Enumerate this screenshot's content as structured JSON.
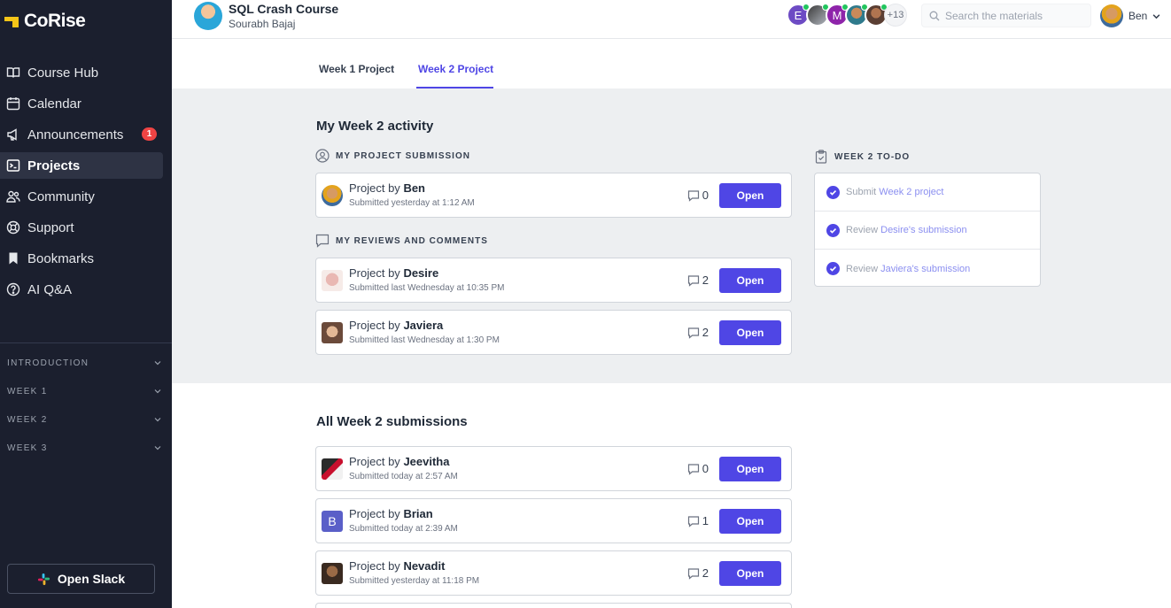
{
  "app": {
    "name": "CoRise"
  },
  "sidebar": {
    "nav": [
      {
        "label": "Course Hub",
        "icon": "book-icon"
      },
      {
        "label": "Calendar",
        "icon": "calendar-icon"
      },
      {
        "label": "Announcements",
        "icon": "megaphone-icon",
        "badge": "1"
      },
      {
        "label": "Projects",
        "icon": "terminal-icon",
        "active": true
      },
      {
        "label": "Community",
        "icon": "people-icon"
      },
      {
        "label": "Support",
        "icon": "lifebuoy-icon"
      },
      {
        "label": "Bookmarks",
        "icon": "bookmark-icon"
      },
      {
        "label": "AI Q&A",
        "icon": "question-icon"
      }
    ],
    "sections": [
      "INTRODUCTION",
      "WEEK 1",
      "WEEK 2",
      "WEEK 3"
    ],
    "slack_label": "Open Slack"
  },
  "header": {
    "course_title": "SQL Crash Course",
    "instructor": "Sourabh Bajaj",
    "avatar_letters": [
      "E",
      "M"
    ],
    "more_count": "+13",
    "search_placeholder": "Search the materials",
    "user_name": "Ben"
  },
  "tabs": [
    {
      "label": "Week 1 Project"
    },
    {
      "label": "Week 2 Project",
      "active": true
    }
  ],
  "activity": {
    "title": "My Week 2 activity",
    "submission_label": "MY PROJECT SUBMISSION",
    "reviews_label": "MY REVIEWS AND COMMENTS",
    "prefix": "Project by",
    "open_label": "Open",
    "my_submission": {
      "name": "Ben",
      "submitted": "Submitted yesterday at 1:12 AM",
      "comments": "0"
    },
    "reviews": [
      {
        "name": "Desire",
        "submitted": "Submitted last Wednesday at 10:35 PM",
        "comments": "2"
      },
      {
        "name": "Javiera",
        "submitted": "Submitted last Wednesday at 1:30 PM",
        "comments": "2"
      }
    ]
  },
  "todo": {
    "title": "WEEK 2 TO-DO",
    "items": [
      {
        "pre": "Submit ",
        "hl": "Week 2 project",
        "post": ""
      },
      {
        "pre": "Review ",
        "hl": "Desire's submission",
        "post": ""
      },
      {
        "pre": "Review ",
        "hl": "Javiera's submission",
        "post": ""
      }
    ]
  },
  "all": {
    "title": "All Week 2 submissions",
    "items": [
      {
        "name": "Jeevitha",
        "submitted": "Submitted today at 2:57 AM",
        "comments": "0"
      },
      {
        "name": "Brian",
        "submitted": "Submitted today at 2:39 AM",
        "comments": "1",
        "initial": "B"
      },
      {
        "name": "Nevadit",
        "submitted": "Submitted yesterday at 11:18 PM",
        "comments": "2"
      }
    ]
  },
  "colors": {
    "accent": "#4f46e5",
    "sidebar_bg": "#1b1f2e",
    "badge": "#ef4444",
    "band": "#edeff1"
  }
}
